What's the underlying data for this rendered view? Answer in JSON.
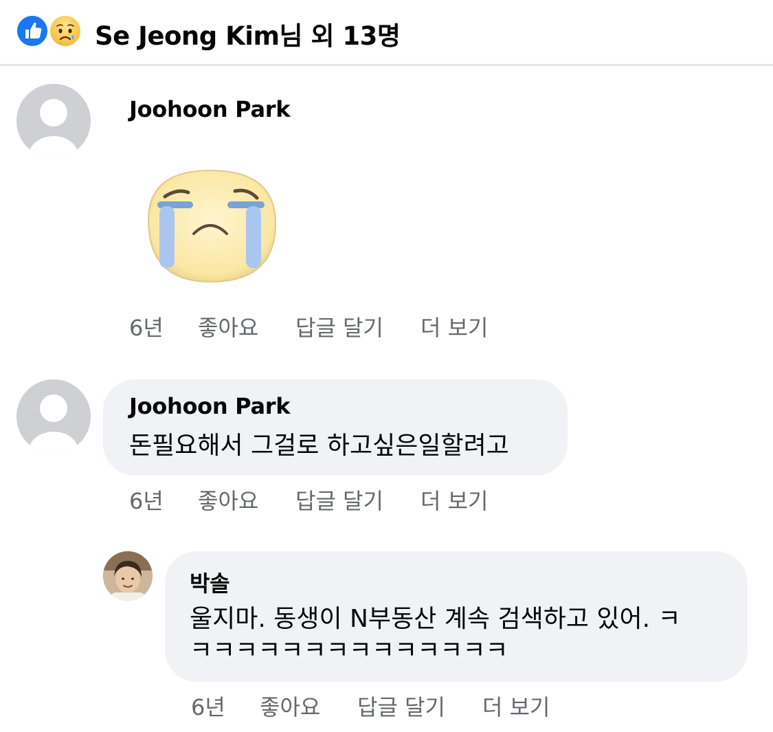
{
  "header": {
    "reaction_icons": [
      "like-icon",
      "sad-icon"
    ],
    "title": "Se Jeong Kim님 외 13명"
  },
  "comments": [
    {
      "author": "Joohoon Park",
      "sticker": "crying-face-sticker",
      "actions": {
        "time": "6년",
        "like": "좋아요",
        "reply": "답글 달기",
        "more": "더 보기"
      }
    },
    {
      "author": "Joohoon Park",
      "text": "돈필요해서 그걸로 하고싶은일할려고",
      "actions": {
        "time": "6년",
        "like": "좋아요",
        "reply": "답글 달기",
        "more": "더 보기"
      }
    },
    {
      "author": "박솔",
      "text_line1": "울지마. 동생이 N부동산 계속 검색하고 있어. ㅋ",
      "text_line2": "ㅋㅋㅋㅋㅋㅋㅋㅋㅋㅋㅋㅋㅋㅋ",
      "actions": {
        "time": "6년",
        "like": "좋아요",
        "reply": "답글 달기",
        "more": "더 보기"
      }
    }
  ],
  "colors": {
    "like_blue": "#1877f2",
    "bubble_bg": "#f0f2f5",
    "meta_gray": "#65676b",
    "divider": "#e4e6eb"
  }
}
